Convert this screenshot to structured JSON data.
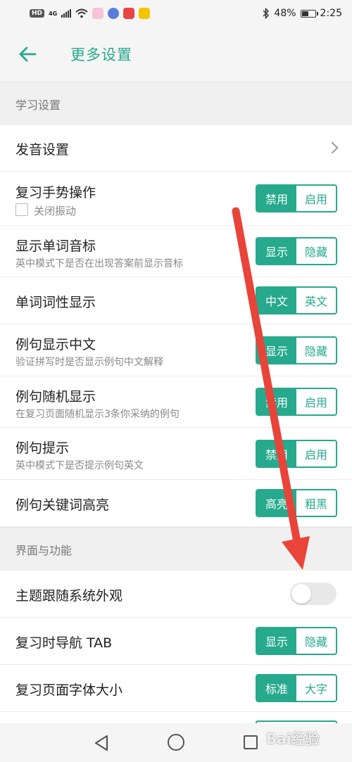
{
  "status_bar": {
    "network_label": "HD",
    "network_gen": "4G",
    "battery_percent": "48%",
    "time": "2:25",
    "battery_level": 0.48
  },
  "header": {
    "title": "更多设置",
    "back_icon": "arrow-left-icon"
  },
  "sections": {
    "study": "学习设置",
    "ui": "界面与功能"
  },
  "rows": {
    "pronunciation": {
      "label": "发音设置"
    },
    "gesture": {
      "label": "复习手势操作",
      "checkbox_label": "关闭振动",
      "options": [
        "禁用",
        "启用"
      ],
      "selected": "禁用"
    },
    "phonetic": {
      "label": "显示单词音标",
      "sub": "英中模式下是否在出现答案前显示音标",
      "options": [
        "显示",
        "隐藏"
      ],
      "selected": "显示"
    },
    "pos": {
      "label": "单词词性显示",
      "options": [
        "中文",
        "英文"
      ],
      "selected": "中文"
    },
    "example_cn": {
      "label": "例句显示中文",
      "sub": "验证拼写时是否显示例句中文解释",
      "options": [
        "显示",
        "隐藏"
      ],
      "selected": "显示"
    },
    "example_random": {
      "label": "例句随机显示",
      "sub": "在复习页面随机显示3条你采纳的例句",
      "options": [
        "禁用",
        "启用"
      ],
      "selected": "禁用"
    },
    "example_hint": {
      "label": "例句提示",
      "sub": "英中模式下是否提示例句英文",
      "options": [
        "禁用",
        "启用"
      ],
      "selected": "禁用"
    },
    "keyword": {
      "label": "例句关键词高亮",
      "options": [
        "高亮",
        "粗黑"
      ],
      "selected": "高亮"
    },
    "theme": {
      "label": "主题跟随系统外观",
      "toggle_on": false
    },
    "nav_tab": {
      "label": "复习时导航 TAB",
      "options": [
        "显示",
        "隐藏"
      ],
      "selected": "显示"
    },
    "font_size": {
      "label": "复习页面字体大小",
      "options": [
        "标准",
        "大字"
      ],
      "selected": "标准"
    }
  },
  "watermark": "Bai经验",
  "colors": {
    "accent": "#26a98c",
    "annotation_arrow": "#e8443a"
  }
}
